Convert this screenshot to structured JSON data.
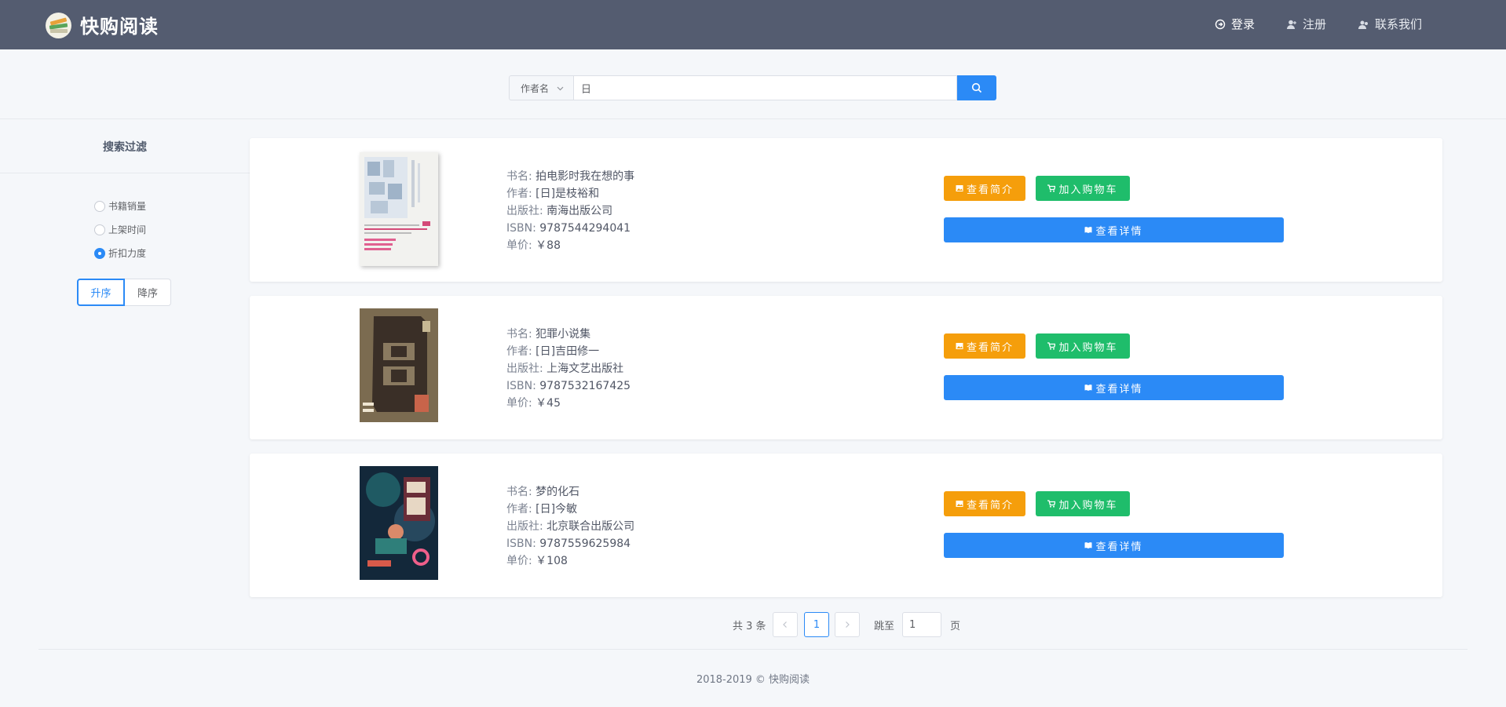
{
  "app": {
    "brand": "快购阅读"
  },
  "nav": {
    "login": "登录",
    "register": "注册",
    "contact": "联系我们"
  },
  "search": {
    "field": "作者名",
    "query": "日"
  },
  "sidebar": {
    "title": "搜索过滤",
    "sort_options": [
      "书籍销量",
      "上架时间",
      "折扣力度"
    ],
    "selected": "折扣力度",
    "order": {
      "asc": "升序",
      "desc": "降序",
      "active": "升序"
    }
  },
  "labels": {
    "name": "书名: ",
    "author": "作者: ",
    "publisher": "出版社: ",
    "isbn": "ISBN: ",
    "price": "单价: "
  },
  "buttons": {
    "intro": "查看简介",
    "cart": "加入购物车",
    "detail": "查看详情"
  },
  "books": [
    {
      "name": "拍电影时我在想的事",
      "author": "[日]是枝裕和",
      "publisher": "南海出版公司",
      "isbn": "9787544294041",
      "price": "￥88"
    },
    {
      "name": "犯罪小说集",
      "author": "[日]吉田修一",
      "publisher": "上海文艺出版社",
      "isbn": "9787532167425",
      "price": "￥45"
    },
    {
      "name": "梦的化石",
      "author": "[日]今敏",
      "publisher": "北京联合出版公司",
      "isbn": "9787559625984",
      "price": "￥108"
    }
  ],
  "pagination": {
    "total_text": "共 3 条",
    "current_page": "1",
    "jump_label": "跳至",
    "jump_value": "1",
    "page_suffix": "页"
  },
  "footer": {
    "text": "2018-2019 © 快购阅读"
  },
  "colors": {
    "header": "#545c70",
    "primary": "#2b8af6",
    "warning": "#f59e0b",
    "success": "#1fbd6b"
  }
}
